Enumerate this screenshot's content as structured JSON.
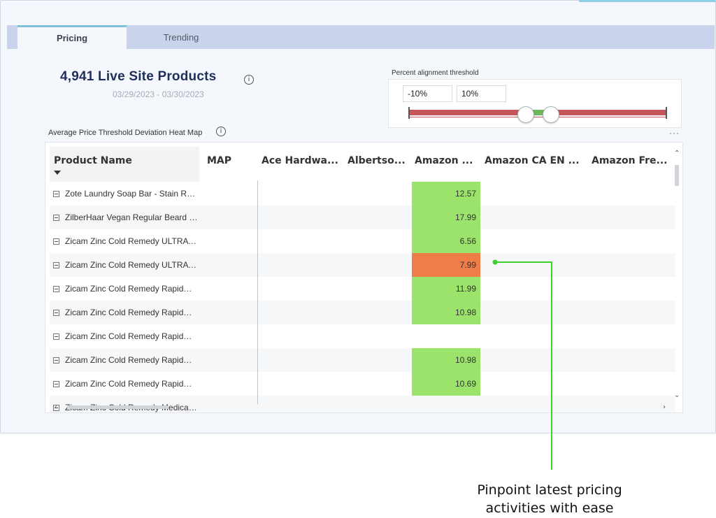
{
  "tabs": [
    {
      "label": "Pricing",
      "active": true
    },
    {
      "label": "Trending",
      "active": false
    }
  ],
  "kpi": {
    "title": "4,941 Live Site Products",
    "info_icon": "info-icon",
    "date_range": "03/29/2023 - 03/30/2023"
  },
  "threshold": {
    "label": "Percent alignment threshold",
    "min_value": "-10%",
    "max_value": "10%",
    "colors": {
      "out_of_range": "#c4555a",
      "in_range": "#6db85a"
    }
  },
  "heatmap": {
    "title": "Average Price Threshold Deviation Heat Map",
    "info_icon": "info-icon",
    "menu_icon": "more-icon",
    "more_label": "···",
    "columns": [
      "Product Name",
      "MAP",
      "Ace Hardwa...",
      "Albertso...",
      "Amazon ...",
      "Amazon CA EN ...",
      "Amazon Fre..."
    ],
    "rows": [
      {
        "name": "Zote Laundry Soap Bar - Stain Remover",
        "amazon": "12.57",
        "status": "green"
      },
      {
        "name": "ZilberHaar Vegan Regular Beard Oil",
        "amazon": "17.99",
        "status": "green"
      },
      {
        "name": "Zicam Zinc Cold Remedy ULTRA Crystals",
        "amazon": "6.56",
        "status": "green"
      },
      {
        "name": "Zicam Zinc Cold Remedy ULTRA Lozenges",
        "amazon": "7.99",
        "status": "orange"
      },
      {
        "name": "Zicam Zinc Cold Remedy RapidMelts",
        "amazon": "11.99",
        "status": "green"
      },
      {
        "name": "Zicam Zinc Cold Remedy RapidMelts",
        "amazon": "10.98",
        "status": "green"
      },
      {
        "name": "Zicam Zinc Cold Remedy RapidMelts",
        "amazon": "",
        "status": "none"
      },
      {
        "name": "Zicam Zinc Cold Remedy RapidMelts",
        "amazon": "10.98",
        "status": "green"
      },
      {
        "name": "Zicam Zinc Cold Remedy RapidMelts",
        "amazon": "10.69",
        "status": "green"
      },
      {
        "name": "Zicam Zinc Cold Remedy Medicated",
        "amazon": "",
        "status": "none"
      }
    ],
    "status_colors": {
      "green": "#9be36b",
      "orange": "#ee7d47",
      "none": "transparent"
    }
  },
  "callout": {
    "line1": "Pinpoint latest pricing",
    "line2": "activities with ease",
    "color": "#3ccf2d"
  }
}
